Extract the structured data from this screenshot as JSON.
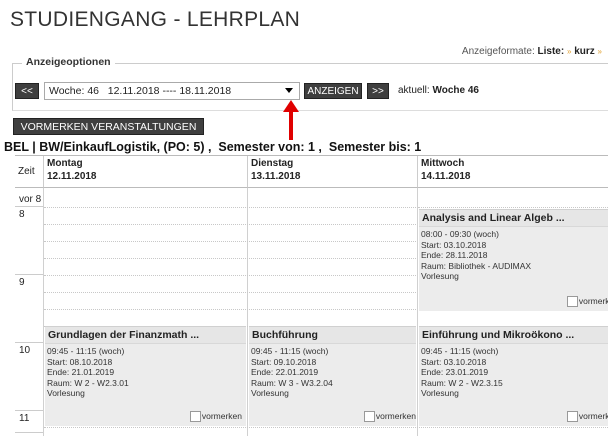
{
  "page_title": "STUDIENGANG - LEHRPLAN",
  "formats": {
    "label": "Anzeigeformate:",
    "list": "Liste:",
    "short": "kurz",
    "sep": "»"
  },
  "options": {
    "legend": "Anzeigeoptionen",
    "prev": "<<",
    "week_value": "Woche: 46   12.11.2018 ---- 18.11.2018",
    "show_button": "ANZEIGEN",
    "next": ">>",
    "current_label": "aktuell:",
    "current_value": "Woche 46"
  },
  "vormerken_button": "VORMERKEN VERANSTALTUNGEN",
  "course_line": "BEL | BW/EinkaufLogistik, (PO: 5) ,  Semester von: 1 ,  Semester bis: 1",
  "grid": {
    "zeit_label": "Zeit",
    "days": [
      {
        "day": "Montag",
        "date": "12.11.2018"
      },
      {
        "day": "Dienstag",
        "date": "13.11.2018"
      },
      {
        "day": "Mittwoch",
        "date": "14.11.2018"
      }
    ],
    "times": [
      "vor 8",
      "8",
      "9",
      "10",
      "11"
    ]
  },
  "events": [
    {
      "title": "Analysis and Linear Algeb ...",
      "time": "08:00 - 09:30 (woch)",
      "start": "Start: 03.10.2018",
      "end": "Ende: 28.11.2018",
      "room": "Raum: Bibliothek - AUDIMAX",
      "type": "Vorlesung",
      "vormerken": "vormerken"
    },
    {
      "title": "Grundlagen der Finanzmath ...",
      "time": "09:45 - 11:15 (woch)",
      "start": "Start: 08.10.2018",
      "end": "Ende: 21.01.2019",
      "room": "Raum: W 2 - W2.3.01",
      "type": "Vorlesung",
      "vormerken": "vormerken"
    },
    {
      "title": "Buchführung",
      "time": "09:45 - 11:15 (woch)",
      "start": "Start: 09.10.2018",
      "end": "Ende: 22.01.2019",
      "room": "Raum: W 3 - W3.2.04",
      "type": "Vorlesung",
      "vormerken": "vormerken"
    },
    {
      "title": "Einführung und Mikroökono ...",
      "time": "09:45 - 11:15 (woch)",
      "start": "Start: 03.10.2018",
      "end": "Ende: 23.01.2019",
      "room": "Raum: W 2 - W2.3.15",
      "type": "Vorlesung",
      "vormerken": "vormerken"
    }
  ],
  "colors": {
    "button_bg": "#3f3f3f",
    "annotation_arrow": "#e00000",
    "event_bg": "#ececec"
  }
}
